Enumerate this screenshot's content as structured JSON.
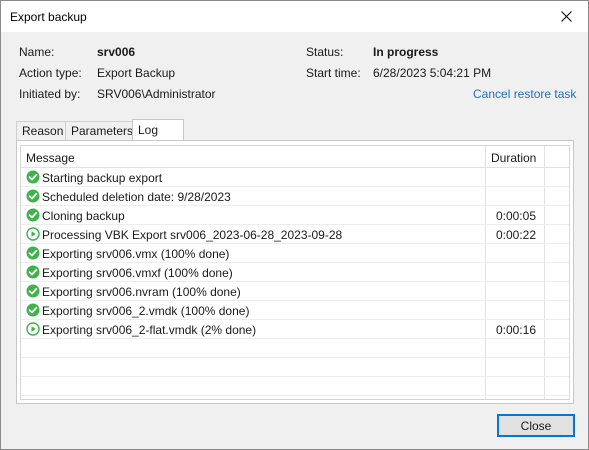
{
  "window": {
    "title": "Export backup"
  },
  "info": {
    "name_label": "Name:",
    "name_value": "srv006",
    "action_label": "Action type:",
    "action_value": "Export Backup",
    "initiated_label": "Initiated by:",
    "initiated_value": "SRV006\\Administrator",
    "status_label": "Status:",
    "status_value": "In progress",
    "start_label": "Start time:",
    "start_value": "6/28/2023 5:04:21 PM",
    "cancel_link": "Cancel restore task"
  },
  "tabs": [
    {
      "label": "Reason"
    },
    {
      "label": "Parameters"
    },
    {
      "label": "Log"
    }
  ],
  "log": {
    "columns": {
      "message": "Message",
      "duration": "Duration"
    },
    "rows": [
      {
        "icon": "success-check-icon",
        "message": "Starting backup export",
        "duration": ""
      },
      {
        "icon": "success-check-icon",
        "message": "Scheduled deletion date: 9/28/2023",
        "duration": ""
      },
      {
        "icon": "success-check-icon",
        "message": "Cloning backup",
        "duration": "0:00:05"
      },
      {
        "icon": "in-progress-play-icon",
        "message": "Processing VBK Export srv006_2023-06-28_2023-09-28",
        "duration": "0:00:22"
      },
      {
        "icon": "success-check-icon",
        "message": "Exporting srv006.vmx (100% done)",
        "duration": ""
      },
      {
        "icon": "success-check-icon",
        "message": "Exporting srv006.vmxf (100% done)",
        "duration": ""
      },
      {
        "icon": "success-check-icon",
        "message": "Exporting srv006.nvram (100% done)",
        "duration": ""
      },
      {
        "icon": "success-check-icon",
        "message": "Exporting srv006_2.vmdk (100% done)",
        "duration": ""
      },
      {
        "icon": "in-progress-play-icon",
        "message": "Exporting srv006_2-flat.vmdk (2% done)",
        "duration": "0:00:16"
      }
    ]
  },
  "footer": {
    "close_label": "Close"
  },
  "colors": {
    "success": "#3db34a",
    "link": "#1f6fbf",
    "accent": "#0078d7"
  }
}
